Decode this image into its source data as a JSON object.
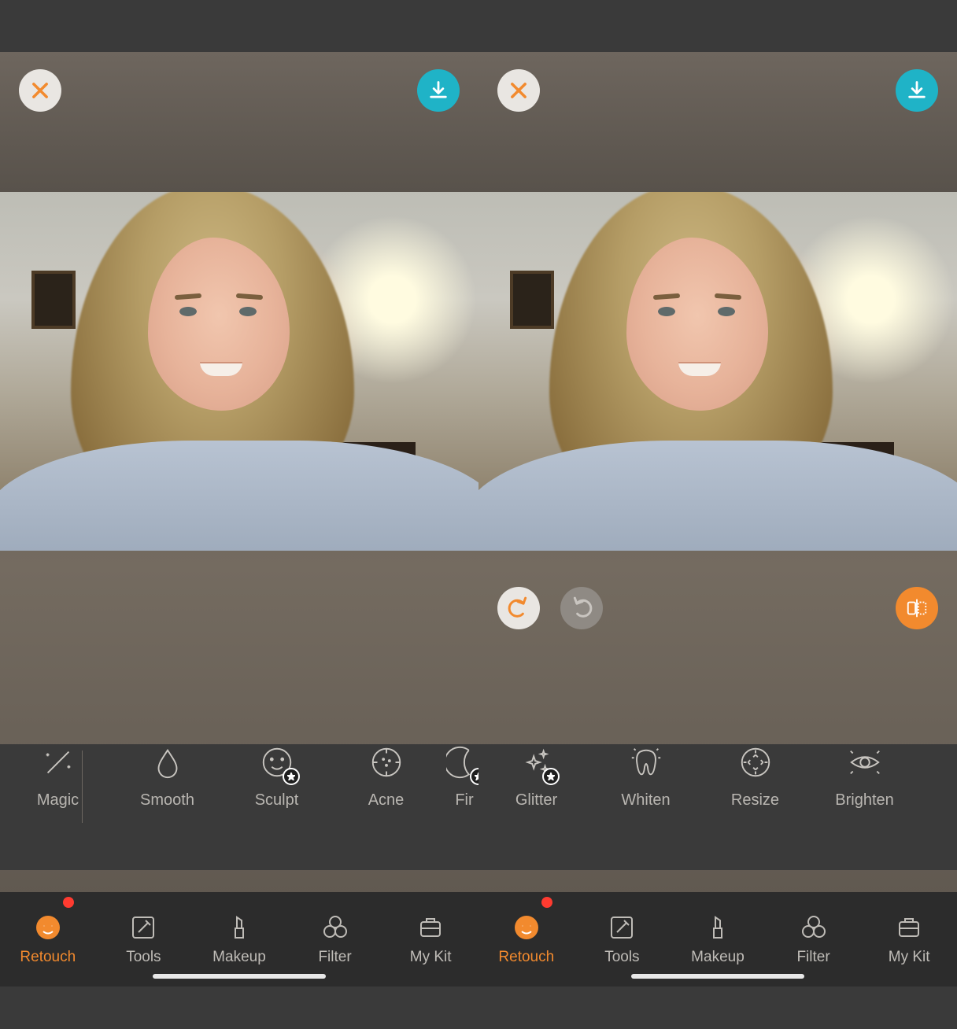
{
  "topbar": {
    "close_icon": "close-icon",
    "download_icon": "download-icon"
  },
  "undo_redo": {
    "undo_icon": "undo-icon",
    "redo_icon": "redo-icon",
    "compare_icon": "compare-icon"
  },
  "retouch_tools": {
    "left": [
      {
        "label": "Magic",
        "icon": "wand-icon",
        "premium": false
      },
      {
        "label": "Smooth",
        "icon": "drop-icon",
        "premium": false
      },
      {
        "label": "Sculpt",
        "icon": "face-icon",
        "premium": true
      },
      {
        "label": "Acne",
        "icon": "target-icon",
        "premium": false
      },
      {
        "label": "Firm",
        "icon": "crescent-icon",
        "premium": true,
        "truncated": "Fir"
      }
    ],
    "right": [
      {
        "label": "Glitter",
        "icon": "sparkle-icon",
        "premium": true
      },
      {
        "label": "Whiten",
        "icon": "tooth-icon",
        "premium": false
      },
      {
        "label": "Resize",
        "icon": "resize-icon",
        "premium": false
      },
      {
        "label": "Brighten",
        "icon": "eye-icon",
        "premium": false
      }
    ]
  },
  "tabs": [
    {
      "label": "Retouch",
      "icon": "face-tab-icon",
      "active": true,
      "notification": true
    },
    {
      "label": "Tools",
      "icon": "pencil-tab-icon",
      "active": false,
      "notification": false
    },
    {
      "label": "Makeup",
      "icon": "lipstick-icon",
      "active": false,
      "notification": false
    },
    {
      "label": "Filter",
      "icon": "circles-icon",
      "active": false,
      "notification": false
    },
    {
      "label": "My Kit",
      "icon": "kit-icon",
      "active": false,
      "notification": false
    }
  ],
  "colors": {
    "accent": "#f28a2e",
    "download": "#1fb3c7",
    "bg": "#3a3a3a",
    "tabbar": "#2c2c2c",
    "notification": "#ff3b30"
  }
}
